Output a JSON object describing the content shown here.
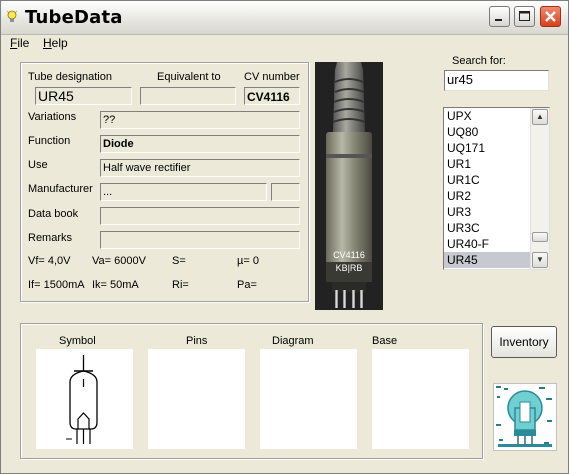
{
  "window": {
    "title": "TubeData",
    "controls": [
      "minimize",
      "maximize",
      "close"
    ],
    "close_color": "#d8401c"
  },
  "menu": [
    {
      "underlined": "F",
      "rest": "ile"
    },
    {
      "underlined": "H",
      "rest": "elp"
    }
  ],
  "details": {
    "designation_label": "Tube designation",
    "designation_value": "UR45",
    "equivalent_label": "Equivalent to",
    "equivalent_value": "",
    "cv_label": "CV number",
    "cv_value": "CV4116",
    "variations_label": "Variations",
    "variations_value": "??",
    "function_label": "Function",
    "function_value": "Diode",
    "use_label": "Use",
    "use_value": "Half wave rectifier",
    "manufacturer_label": "Manufacturer",
    "manufacturer_value": "...",
    "manufacturer_code": "",
    "databook_label": "Data book",
    "databook_value": "",
    "remarks_label": "Remarks",
    "remarks_value": ""
  },
  "params": {
    "vf": "Vf= 4,0V",
    "va": "Va= 6000V",
    "s": "S=",
    "mu": "µ=   0",
    "if": "If= 1500mA",
    "ik": "Ik=  50mA",
    "ri": "Ri=",
    "pa": "Pa="
  },
  "photo": {
    "label_line1": "CV4116",
    "label_line2": "KB|RB"
  },
  "search": {
    "label": "Search for:",
    "value": "ur45",
    "results": [
      "UPX",
      "UQ80",
      "UQ171",
      "UR1",
      "UR1C",
      "UR2",
      "UR3",
      "UR3C",
      "UR40-F",
      "UR45"
    ],
    "selected": "UR45"
  },
  "panes": {
    "symbol": "Symbol",
    "pins": "Pins",
    "diagram": "Diagram",
    "base": "Base"
  },
  "buttons": {
    "inventory": "Inventory"
  },
  "icons": {
    "app": "lightbulb-icon",
    "logo": "tube-logo-icon"
  }
}
